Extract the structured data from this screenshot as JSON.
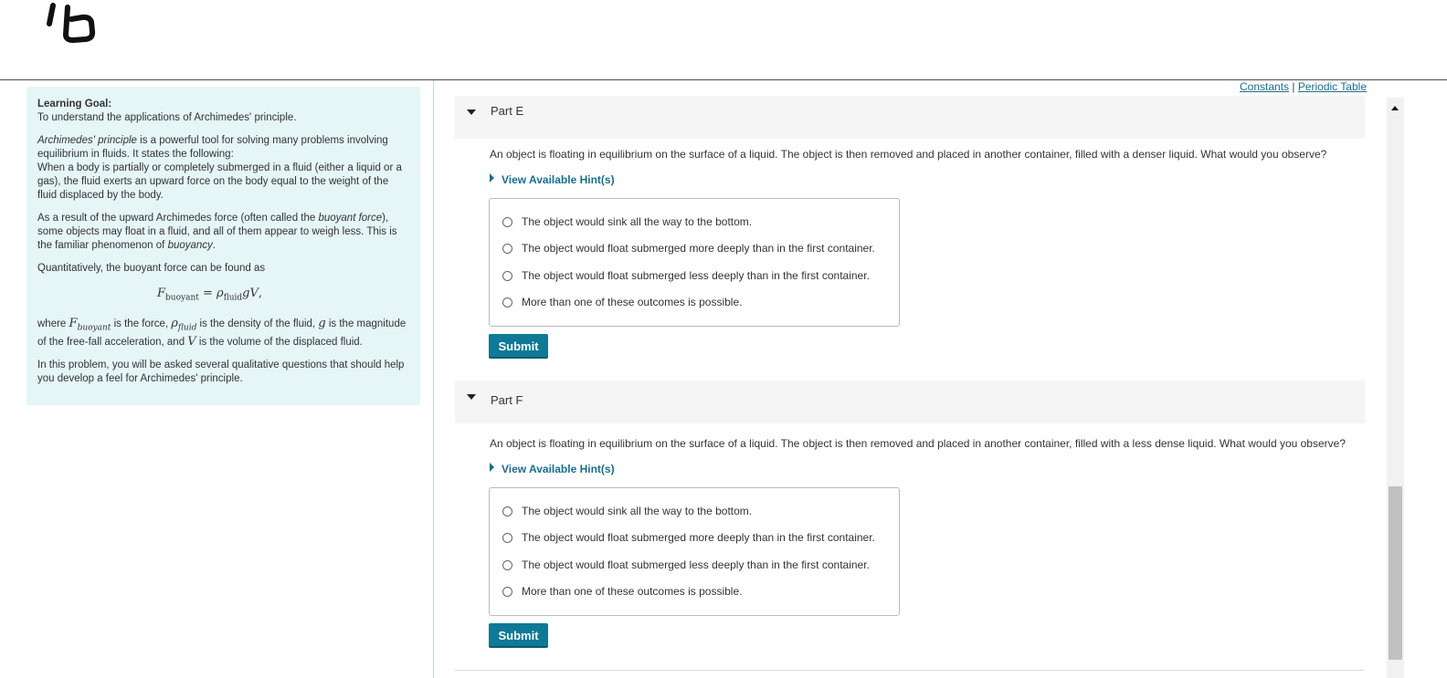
{
  "intro": {
    "goal_label": "Learning Goal:",
    "goal_text": "To understand the applications of Archimedes' principle.",
    "p1_em": "Archimedes' principle",
    "p1_rest": " is a powerful tool for solving many problems involving equilibrium in fluids. It states the following:",
    "p1_statement": "When a body is partially or completely submerged in a fluid (either a liquid or a gas), the fluid exerts an upward force on the body equal to the weight of the fluid displaced by the body.",
    "p2_a": "As a result of the upward Archimedes force (often called the ",
    "p2_em1": "buoyant force",
    "p2_b": "), some objects may float in a fluid, and all of them appear to weigh less. This is the familiar phenomenon of ",
    "p2_em2": "buoyancy",
    "p2_c": ".",
    "p3": "Quantitatively, the buoyant force can be found as",
    "formula": {
      "F": "F",
      "F_sub": "buoyant",
      "eq": " = ",
      "rho": "ρ",
      "rho_sub": "fluid",
      "rest": "gV",
      "end": ","
    },
    "p4_a": "where ",
    "p4_b": " is the force, ",
    "p4_c": " is the density of the fluid, ",
    "p4_g": "g",
    "p4_d": " is the magnitude of the free-fall acceleration, and ",
    "p4_V": "V",
    "p4_e": " is the volume of the displaced fluid.",
    "p5": "In this problem, you will be asked several qualitative questions that should help you develop a feel for Archimedes' principle."
  },
  "links": {
    "constants": "Constants",
    "separator": " | ",
    "periodic_table": "Periodic Table"
  },
  "parts": [
    {
      "label": "Part E",
      "question": "An object is floating in equilibrium on the surface of a liquid. The object is then removed and placed in another container, filled with a denser liquid. What would you observe?",
      "hint": "View Available Hint(s)",
      "choices": [
        "The object would sink all the way to the bottom.",
        "The object would float submerged more deeply than in the first container.",
        "The object would float submerged less deeply than in the first container.",
        "More than one of these outcomes is possible."
      ],
      "submit": "Submit"
    },
    {
      "label": "Part F",
      "question": "An object is floating in equilibrium on the surface of a liquid. The object is then removed and placed in another container, filled with a less dense liquid. What would you observe?",
      "hint": "View Available Hint(s)",
      "choices": [
        "The object would sink all the way to the bottom.",
        "The object would float submerged more deeply than in the first container.",
        "The object would float submerged less deeply than in the first container.",
        "More than one of these outcomes is possible."
      ],
      "submit": "Submit"
    }
  ],
  "colors": {
    "accent": "#0e7a96",
    "link": "#1a6d8e",
    "intro_bg": "#e6f5f6"
  }
}
